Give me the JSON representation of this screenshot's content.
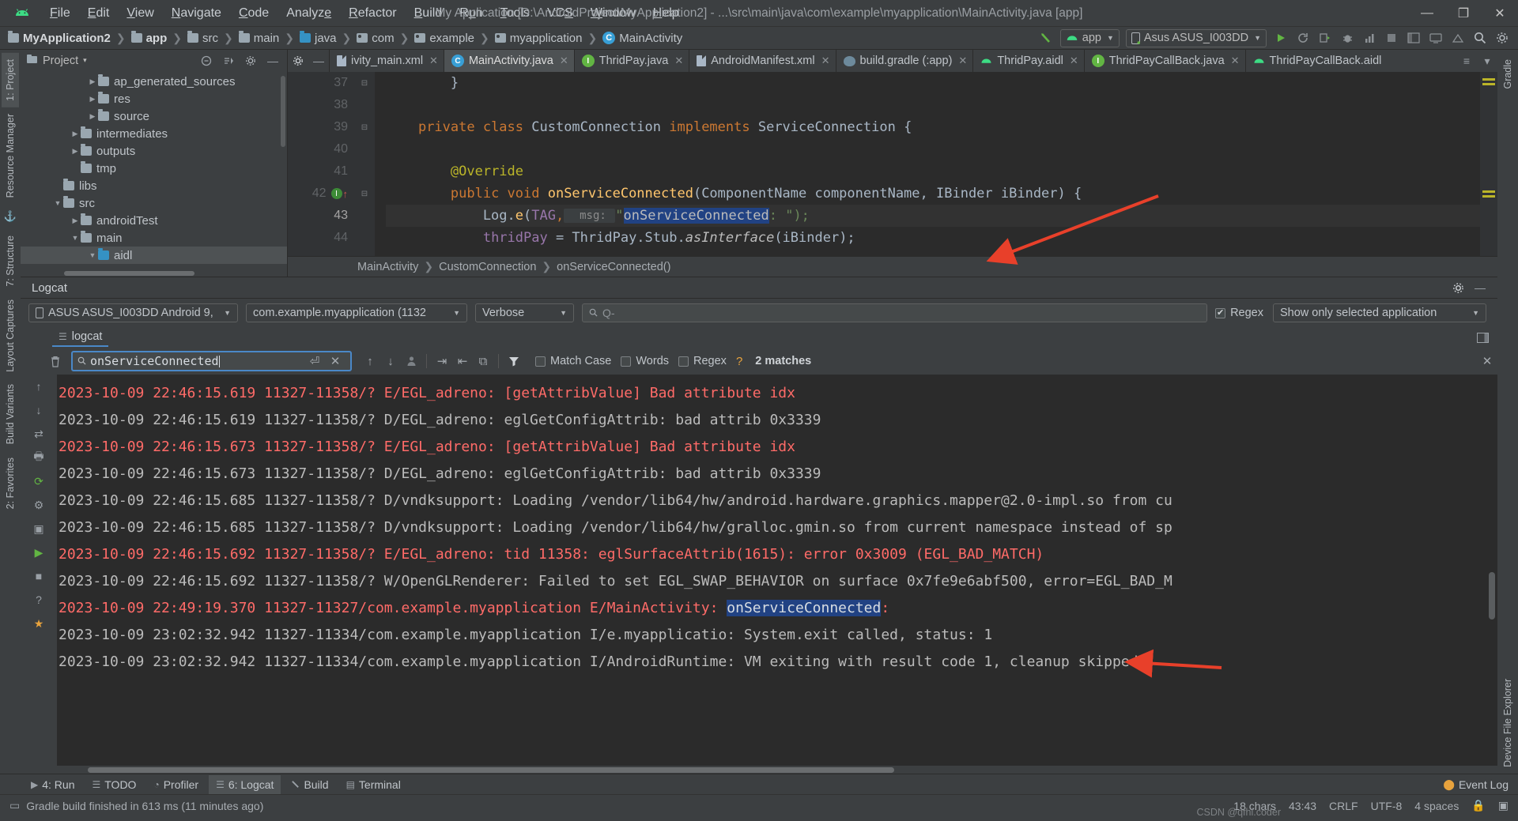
{
  "window": {
    "title": "My Application [D:\\AndroidProject\\MyApplication2] - ...\\src\\main\\java\\com\\example\\myapplication\\MainActivity.java [app]",
    "minimize": "—",
    "maximize": "❐",
    "close": "✕"
  },
  "menu": [
    "File",
    "Edit",
    "View",
    "Navigate",
    "Code",
    "Analyze",
    "Refactor",
    "Build",
    "Run",
    "Tools",
    "VCS",
    "Window",
    "Help"
  ],
  "breadcrumb": [
    {
      "label": "MyApplication2",
      "icon": "module-folder-icon"
    },
    {
      "label": "app",
      "icon": "app-module-icon"
    },
    {
      "label": "src",
      "icon": "folder-icon"
    },
    {
      "label": "main",
      "icon": "folder-icon"
    },
    {
      "label": "java",
      "icon": "source-folder-icon"
    },
    {
      "label": "com",
      "icon": "package-icon"
    },
    {
      "label": "example",
      "icon": "package-icon"
    },
    {
      "label": "myapplication",
      "icon": "package-icon"
    },
    {
      "label": "MainActivity",
      "icon": "class-icon"
    }
  ],
  "toolbar": {
    "run_config": "app",
    "device": "Asus ASUS_I003DD",
    "run_label": "Run",
    "rerun_label": "Rerun",
    "debug_label": "Debug",
    "search_label": "Search everywhere",
    "settings_label": "Settings"
  },
  "project_panel": {
    "title": "Project",
    "caret": "▾",
    "tree": [
      {
        "label": "ap_generated_sources",
        "depth": 3,
        "arrow": "▶",
        "icon": "folder-icon",
        "selected": false
      },
      {
        "label": "res",
        "depth": 3,
        "arrow": "▶",
        "icon": "folder-icon",
        "selected": false
      },
      {
        "label": "source",
        "depth": 3,
        "arrow": "▶",
        "icon": "folder-icon",
        "selected": false
      },
      {
        "label": "intermediates",
        "depth": 2,
        "arrow": "▶",
        "icon": "folder-icon",
        "selected": false
      },
      {
        "label": "outputs",
        "depth": 2,
        "arrow": "▶",
        "icon": "folder-icon",
        "selected": false
      },
      {
        "label": "tmp",
        "depth": 2,
        "arrow": "",
        "icon": "folder-icon",
        "selected": false
      },
      {
        "label": "libs",
        "depth": 1,
        "arrow": "",
        "icon": "folder-icon",
        "selected": false
      },
      {
        "label": "src",
        "depth": 1,
        "arrow": "▼",
        "icon": "folder-icon",
        "selected": false
      },
      {
        "label": "androidTest",
        "depth": 2,
        "arrow": "▶",
        "icon": "folder-icon",
        "selected": false
      },
      {
        "label": "main",
        "depth": 2,
        "arrow": "▼",
        "icon": "folder-icon",
        "selected": false
      },
      {
        "label": "aidl",
        "depth": 3,
        "arrow": "▼",
        "icon": "source-folder-icon",
        "selected": true
      }
    ]
  },
  "editor_tabs": [
    {
      "label": "ivity_main.xml",
      "icon": "xml-file-icon",
      "active": false
    },
    {
      "label": "MainActivity.java",
      "icon": "java-class-icon",
      "active": true
    },
    {
      "label": "ThridPay.java",
      "icon": "java-interface-icon",
      "active": false
    },
    {
      "label": "AndroidManifest.xml",
      "icon": "manifest-file-icon",
      "active": false
    },
    {
      "label": "build.gradle (:app)",
      "icon": "gradle-file-icon",
      "active": false
    },
    {
      "label": "ThridPay.aidl",
      "icon": "aidl-file-icon",
      "active": false
    },
    {
      "label": "ThridPayCallBack.java",
      "icon": "java-interface-icon",
      "active": false
    },
    {
      "label": "ThridPayCallBack.aidl",
      "icon": "aidl-file-icon",
      "active": false
    }
  ],
  "editor": {
    "line_numbers": [
      "37",
      "38",
      "39",
      "40",
      "41",
      "42",
      "43",
      "44"
    ],
    "current_line": "43",
    "gutter_marks": {
      "line": "42",
      "badge": "I",
      "arrow": "↑"
    },
    "lines": [
      {
        "n": "37",
        "tokens": [
          {
            "t": "        }",
            "c": "cls"
          }
        ]
      },
      {
        "n": "38",
        "tokens": []
      },
      {
        "n": "39",
        "tokens": [
          {
            "t": "    ",
            "c": "cls"
          },
          {
            "t": "private class ",
            "c": "kw"
          },
          {
            "t": "CustomConnection ",
            "c": "cls"
          },
          {
            "t": "implements ",
            "c": "kw"
          },
          {
            "t": "ServiceConnection {",
            "c": "cls"
          }
        ]
      },
      {
        "n": "40",
        "tokens": []
      },
      {
        "n": "41",
        "tokens": [
          {
            "t": "        ",
            "c": "cls"
          },
          {
            "t": "@Override",
            "c": "ann"
          }
        ]
      },
      {
        "n": "42",
        "tokens": [
          {
            "t": "        ",
            "c": "cls"
          },
          {
            "t": "public void ",
            "c": "kw"
          },
          {
            "t": "onServiceConnected",
            "c": "mth"
          },
          {
            "t": "(ComponentName componentName, IBinder iBinder) {",
            "c": "cls"
          }
        ]
      },
      {
        "n": "43",
        "tokens": [
          {
            "t": "            Log.",
            "c": "cls"
          },
          {
            "t": "e",
            "c": "mth"
          },
          {
            "t": "(",
            "c": "cls"
          },
          {
            "t": "TAG",
            "c": "fld"
          },
          {
            "t": ",",
            "c": "kw"
          },
          {
            "t": "  msg: ",
            "c": "hint"
          },
          {
            "t": "\"",
            "c": "str"
          },
          {
            "t": "onServiceConnected",
            "c": "selhl"
          },
          {
            "t": ": \");",
            "c": "str"
          }
        ]
      },
      {
        "n": "44",
        "tokens": [
          {
            "t": "            ",
            "c": "cls"
          },
          {
            "t": "thridPay ",
            "c": "fld"
          },
          {
            "t": "= ThridPay.Stub.",
            "c": "cls"
          },
          {
            "t": "asInterface",
            "c": "italic"
          },
          {
            "t": "(iBinder);",
            "c": "cls"
          }
        ]
      }
    ],
    "breadcrumb": [
      "MainActivity",
      "CustomConnection",
      "onServiceConnected()"
    ]
  },
  "logcat": {
    "panel_title": "Logcat",
    "subtab": "logcat",
    "device_filter": "ASUS ASUS_I003DD Android 9, /",
    "process_filter": "com.example.myapplication (1132",
    "level_filter": "Verbose",
    "search_placeholder": "Q-",
    "regex_label": "Regex",
    "regex_checked": true,
    "scope_filter": "Show only selected application",
    "find": {
      "value": "onServiceConnected",
      "match_case_label": "Match Case",
      "words_label": "Words",
      "regex_label": "Regex",
      "help": "?",
      "matches": "2 matches",
      "prev_label": "Previous Occurrence",
      "next_label": "Next Occurrence",
      "close_label": "Close"
    },
    "lines": [
      {
        "text": "2023-10-09 22:46:15.619 11327-11358/? E/EGL_adreno: [getAttribValue] Bad attribute idx",
        "level": "error"
      },
      {
        "text": "2023-10-09 22:46:15.619 11327-11358/? D/EGL_adreno: eglGetConfigAttrib: bad attrib 0x3339",
        "level": "debug"
      },
      {
        "text": "2023-10-09 22:46:15.673 11327-11358/? E/EGL_adreno: [getAttribValue] Bad attribute idx",
        "level": "error"
      },
      {
        "text": "2023-10-09 22:46:15.673 11327-11358/? D/EGL_adreno: eglGetConfigAttrib: bad attrib 0x3339",
        "level": "debug"
      },
      {
        "text": "2023-10-09 22:46:15.685 11327-11358/? D/vndksupport: Loading /vendor/lib64/hw/android.hardware.graphics.mapper@2.0-impl.so from cu",
        "level": "debug"
      },
      {
        "text": "2023-10-09 22:46:15.685 11327-11358/? D/vndksupport: Loading /vendor/lib64/hw/gralloc.gmin.so from current namespace instead of sp",
        "level": "debug"
      },
      {
        "text": "2023-10-09 22:46:15.692 11327-11358/? E/EGL_adreno: tid 11358: eglSurfaceAttrib(1615): error 0x3009 (EGL_BAD_MATCH)",
        "level": "error"
      },
      {
        "text": "2023-10-09 22:46:15.692 11327-11358/? W/OpenGLRenderer: Failed to set EGL_SWAP_BEHAVIOR on surface 0x7fe9e6abf500, error=EGL_BAD_M",
        "level": "debug"
      },
      {
        "text": "2023-10-09 22:49:19.370 11327-11327/com.example.myapplication E/MainActivity: ",
        "highlight": "onServiceConnected",
        "suffix": ":",
        "level": "error"
      },
      {
        "text": "2023-10-09 23:02:32.942 11327-11334/com.example.myapplication I/e.myapplicatio: System.exit called, status: 1",
        "level": "debug"
      },
      {
        "text": "2023-10-09 23:02:32.942 11327-11334/com.example.myapplication I/AndroidRuntime: VM exiting with result code 1, cleanup skipped.",
        "level": "debug"
      }
    ]
  },
  "left_rail": [
    {
      "label": "1: Project",
      "selected": true
    },
    {
      "label": "Resource Manager",
      "selected": false
    },
    {
      "label": "7: Structure",
      "selected": false
    },
    {
      "label": "Layout Captures",
      "selected": false
    },
    {
      "label": "Build Variants",
      "selected": false
    },
    {
      "label": "2: Favorites",
      "selected": false
    }
  ],
  "right_rail": [
    {
      "label": "Gradle",
      "selected": false
    },
    {
      "label": "Device File Explorer",
      "selected": false
    }
  ],
  "bottom_tabs": [
    {
      "label": "4: Run",
      "icon": "run-icon",
      "selected": false
    },
    {
      "label": "TODO",
      "icon": "todo-icon",
      "selected": false
    },
    {
      "label": "Profiler",
      "icon": "profiler-icon",
      "selected": false
    },
    {
      "label": "6: Logcat",
      "icon": "logcat-icon",
      "selected": true
    },
    {
      "label": "Build",
      "icon": "build-icon",
      "selected": false
    },
    {
      "label": "Terminal",
      "icon": "terminal-icon",
      "selected": false
    }
  ],
  "event_log": "Event Log",
  "status": {
    "message": "Gradle build finished in 613 ms (11 minutes ago)",
    "chars": "18 chars",
    "caret": "43:43",
    "line_sep": "CRLF",
    "encoding": "UTF-8",
    "indent": "4 spaces",
    "watermark": "CSDN @qfhl.coder"
  },
  "colors": {
    "accent": "#4a88c7",
    "error": "#ff6b68",
    "selection": "#214283",
    "green": "#62b543",
    "annotation_arrow": "#e8402a"
  }
}
